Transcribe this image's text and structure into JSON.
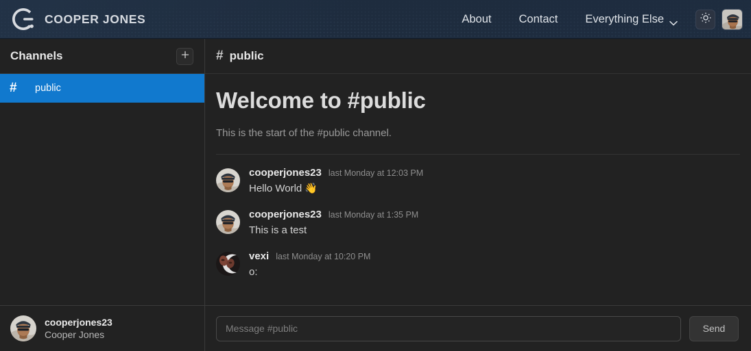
{
  "header": {
    "brand": {
      "logo_icon": "g-dot-logo-icon",
      "name": "COOPER JONES"
    },
    "nav": [
      {
        "label": "About",
        "type": "link"
      },
      {
        "label": "Contact",
        "type": "link"
      },
      {
        "label": "Everything Else",
        "type": "dropdown",
        "chevron_icon": "chevron-down-icon"
      }
    ],
    "theme_toggle": {
      "icon": "sun-brightness-icon",
      "label": ""
    },
    "account_avatar": {
      "icon": "user-avatar-icon",
      "alt": "cooperjones23"
    }
  },
  "sidebar": {
    "title": "Channels",
    "add_button": {
      "icon": "plus-icon",
      "label": "+"
    },
    "channels": [
      {
        "hash": "#",
        "name": "public",
        "active": true
      }
    ],
    "user": {
      "handle": "cooperjones23",
      "display_name": "Cooper Jones",
      "avatar_icon": "user-avatar-icon"
    }
  },
  "main": {
    "channel_header": {
      "hash": "#",
      "name": "public"
    },
    "welcome": {
      "title": "Welcome to #public",
      "subtitle": "This is the start of the #public channel."
    },
    "messages": [
      {
        "author": "cooperjones23",
        "timestamp": "last Monday at 12:03 PM",
        "text": "Hello World",
        "emoji": "👋",
        "avatar_icon": "user-avatar-icon"
      },
      {
        "author": "cooperjones23",
        "timestamp": "last Monday at 1:35 PM",
        "text": "This is a test",
        "emoji": "",
        "avatar_icon": "user-avatar-icon"
      },
      {
        "author": "vexi",
        "timestamp": "last Monday at 10:20 PM",
        "text": "o:",
        "emoji": "",
        "avatar_icon": "moon-avatar-icon"
      }
    ],
    "composer": {
      "placeholder": "Message #public",
      "value": "",
      "send_label": "Send"
    }
  },
  "colors": {
    "header_bg": "#1e2c3e",
    "sidebar_bg": "#222222",
    "main_bg": "#222222",
    "active_channel": "#1179ce",
    "divider": "#3a3a3a",
    "text_primary": "#e6e6e6",
    "text_muted": "#8e8e8e"
  }
}
